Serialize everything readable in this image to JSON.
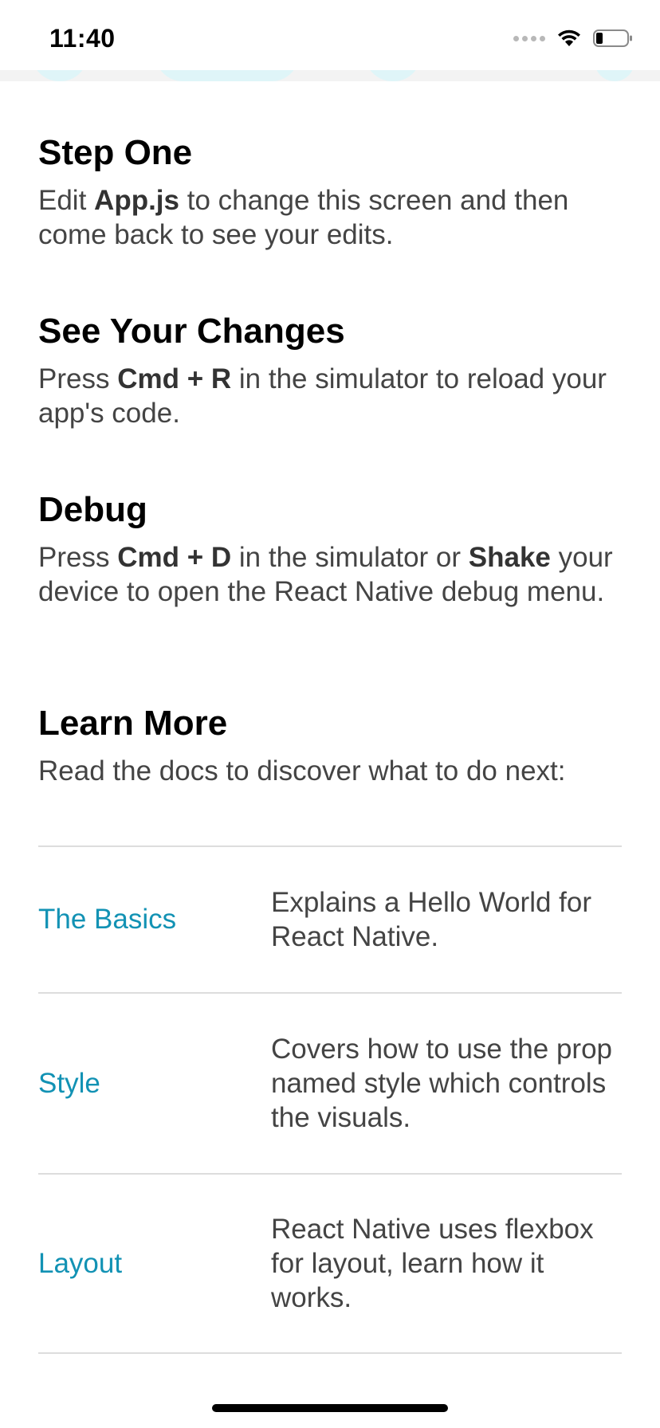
{
  "status_bar": {
    "time": "11:40"
  },
  "sections": [
    {
      "title": "Step One",
      "desc_parts": [
        "Edit ",
        "App.js",
        " to change this screen and then come back to see your edits."
      ]
    },
    {
      "title": "See Your Changes",
      "desc_parts": [
        "Press ",
        "Cmd + R",
        " in the simulator to reload your app's code."
      ]
    },
    {
      "title": "Debug",
      "desc_parts": [
        "Press ",
        "Cmd + D",
        " in the simulator or ",
        "Shake",
        " your device to open the React Native debug menu."
      ]
    },
    {
      "title": "Learn More",
      "desc": "Read the docs to discover what to do next:"
    }
  ],
  "links": [
    {
      "title": "The Basics",
      "desc": "Explains a Hello World for React Native."
    },
    {
      "title": "Style",
      "desc": "Covers how to use the prop named style which controls the visuals."
    },
    {
      "title": "Layout",
      "desc": "React Native uses flexbox for layout, learn how it works."
    }
  ],
  "colors": {
    "link": "#1292b4",
    "body_text": "#444444",
    "divider": "#dddddd",
    "header_blob": "#dff5f8"
  },
  "icons": [
    "cellular-signal-icon",
    "wifi-icon",
    "battery-icon"
  ]
}
